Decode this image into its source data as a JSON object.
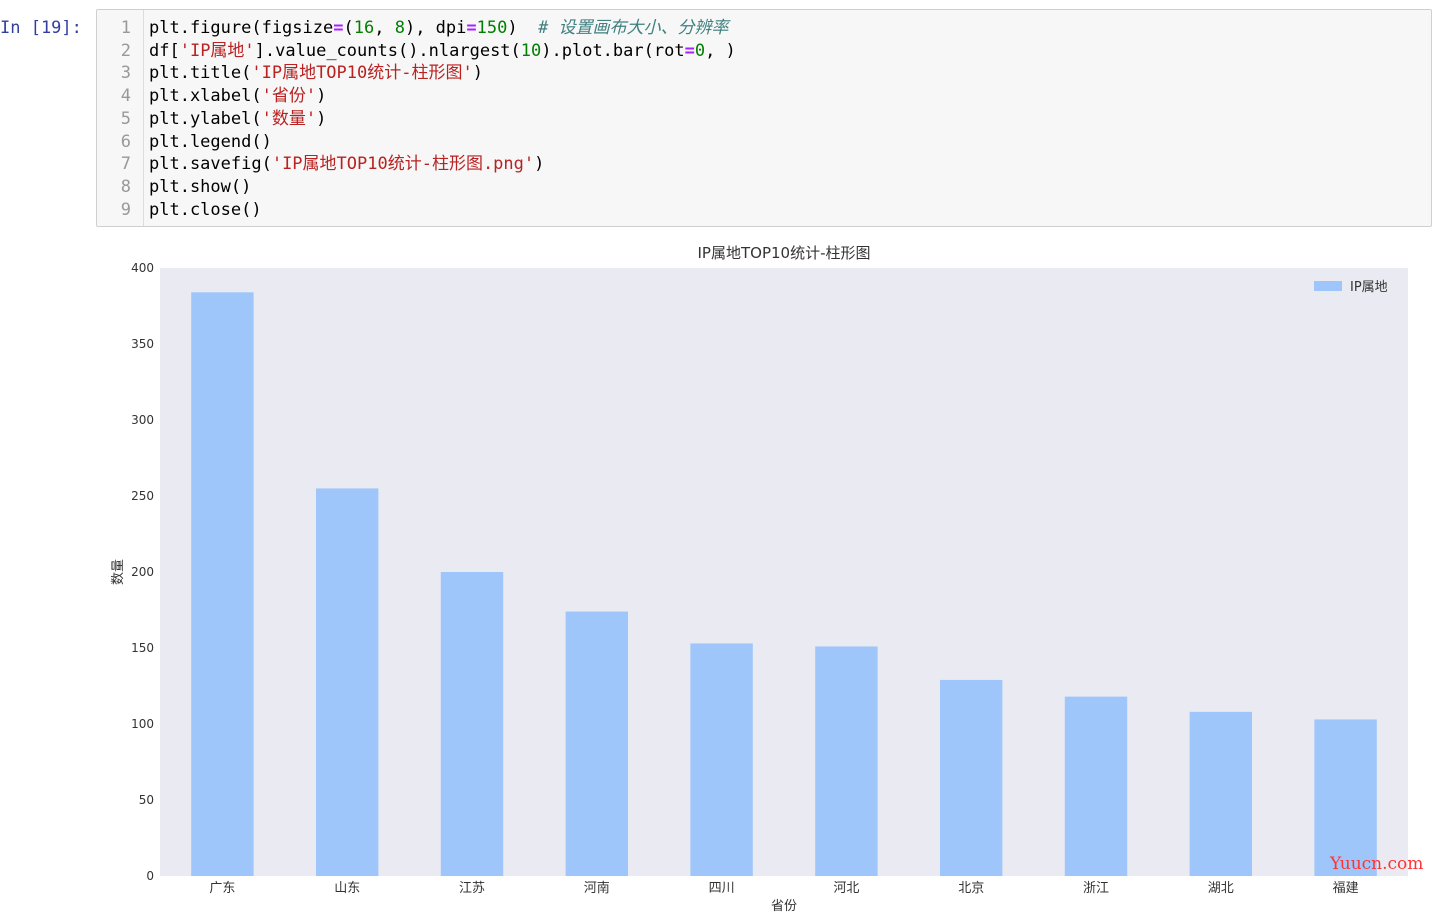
{
  "cell": {
    "prompt": "In [19]:",
    "lines": [
      {
        "n": "1",
        "tokens": [
          [
            "plt.figure(figsize",
            ""
          ],
          [
            "=",
            "op"
          ],
          [
            "(",
            ""
          ],
          [
            "16",
            "num"
          ],
          [
            ", ",
            ""
          ],
          [
            "8",
            "num"
          ],
          [
            "), dpi",
            ""
          ],
          [
            "=",
            "op"
          ],
          [
            "150",
            "num"
          ],
          [
            ")  ",
            ""
          ],
          [
            "# 设置画布大小、分辨率",
            "com"
          ]
        ]
      },
      {
        "n": "2",
        "tokens": [
          [
            "df[",
            ""
          ],
          [
            "'IP属地'",
            "str"
          ],
          [
            "].value_counts().nlargest(",
            ""
          ],
          [
            "10",
            "num"
          ],
          [
            ").plot.bar(rot",
            ""
          ],
          [
            "=",
            "op"
          ],
          [
            "0",
            "num"
          ],
          [
            ", )",
            ""
          ]
        ]
      },
      {
        "n": "3",
        "tokens": [
          [
            "plt.title(",
            ""
          ],
          [
            "'IP属地TOP10统计-柱形图'",
            "str"
          ],
          [
            ")",
            ""
          ]
        ]
      },
      {
        "n": "4",
        "tokens": [
          [
            "plt.xlabel(",
            ""
          ],
          [
            "'省份'",
            "str"
          ],
          [
            ")",
            ""
          ]
        ]
      },
      {
        "n": "5",
        "tokens": [
          [
            "plt.ylabel(",
            ""
          ],
          [
            "'数量'",
            "str"
          ],
          [
            ")",
            ""
          ]
        ]
      },
      {
        "n": "6",
        "tokens": [
          [
            "plt.legend()",
            ""
          ]
        ]
      },
      {
        "n": "7",
        "tokens": [
          [
            "plt.savefig(",
            ""
          ],
          [
            "'IP属地TOP10统计-柱形图.png'",
            "str"
          ],
          [
            ")",
            ""
          ]
        ]
      },
      {
        "n": "8",
        "tokens": [
          [
            "plt.show()",
            ""
          ]
        ]
      },
      {
        "n": "9",
        "tokens": [
          [
            "plt.close()",
            ""
          ]
        ]
      }
    ]
  },
  "chart_data": {
    "type": "bar",
    "title": "IP属地TOP10统计-柱形图",
    "xlabel": "省份",
    "ylabel": "数量",
    "categories": [
      "广东",
      "山东",
      "江苏",
      "河南",
      "四川",
      "河北",
      "北京",
      "浙江",
      "湖北",
      "福建"
    ],
    "series": [
      {
        "name": "IP属地",
        "values": [
          384,
          255,
          200,
          174,
          153,
          151,
          129,
          118,
          108,
          103
        ]
      }
    ],
    "ylim": [
      0,
      400
    ],
    "yticks": [
      0,
      50,
      100,
      150,
      200,
      250,
      300,
      350,
      400
    ],
    "grid": false,
    "legend_position": "top-right",
    "colors": {
      "bar": "#9ec6fa",
      "plot_background": "#eaeaf2"
    }
  },
  "watermark": "Yuucn.com"
}
